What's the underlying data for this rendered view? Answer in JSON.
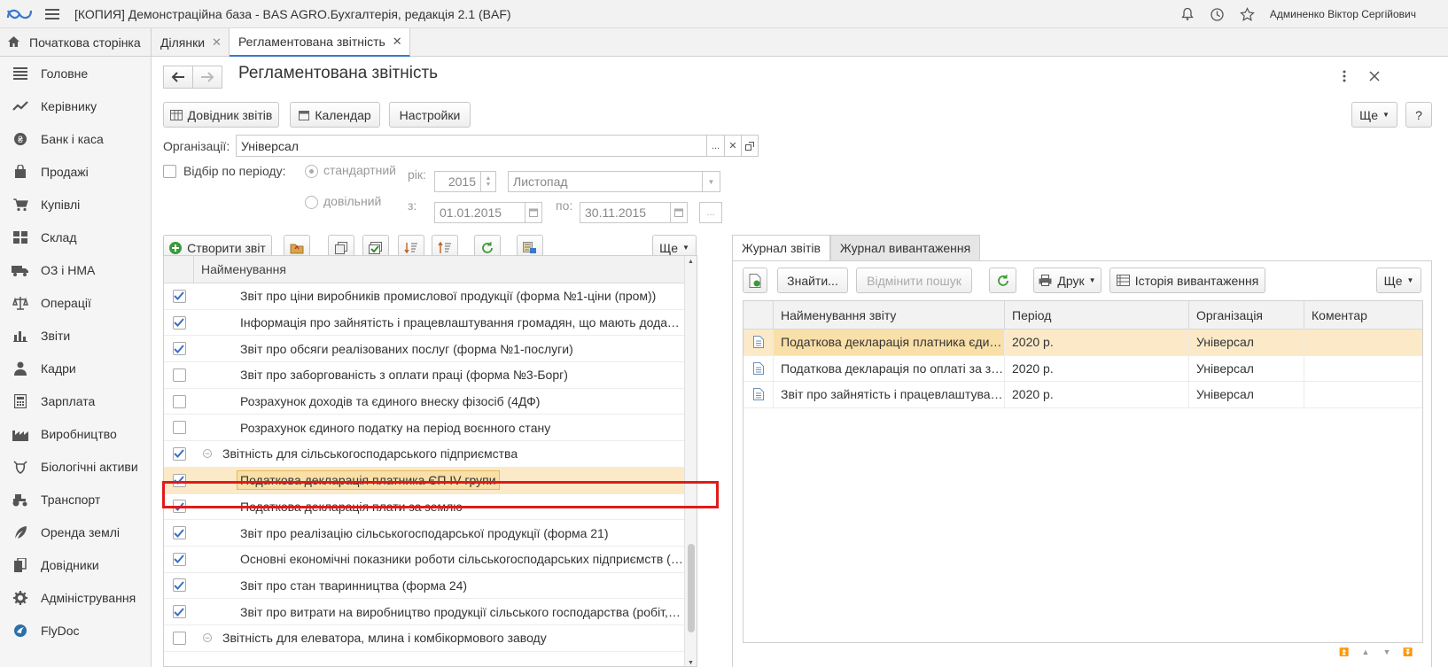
{
  "app": {
    "title": "[КОПИЯ] Демонстраційна база - BAS AGRO.Бухгалтерія, редакція 2.1  (BAF)",
    "user": "Админенко Віктор Сергійович"
  },
  "tabs": {
    "home": "Початкова сторінка",
    "items": [
      {
        "label": "Ділянки"
      },
      {
        "label": "Регламентована звітність"
      }
    ]
  },
  "sidebar": {
    "items": [
      {
        "label": "Головне",
        "icon": "list-icon"
      },
      {
        "label": "Керівнику",
        "icon": "trend-icon"
      },
      {
        "label": "Банк і каса",
        "icon": "coin-icon"
      },
      {
        "label": "Продажі",
        "icon": "bag-icon"
      },
      {
        "label": "Купівлі",
        "icon": "cart-icon"
      },
      {
        "label": "Склад",
        "icon": "grid-icon"
      },
      {
        "label": "ОЗ і НМА",
        "icon": "truck-icon"
      },
      {
        "label": "Операції",
        "icon": "scales-icon"
      },
      {
        "label": "Звіти",
        "icon": "bar-chart-icon"
      },
      {
        "label": "Кадри",
        "icon": "person-icon"
      },
      {
        "label": "Зарплата",
        "icon": "calculator-icon"
      },
      {
        "label": "Виробництво",
        "icon": "factory-icon"
      },
      {
        "label": "Біологічні активи",
        "icon": "cow-icon"
      },
      {
        "label": "Транспорт",
        "icon": "tractor-icon"
      },
      {
        "label": "Оренда землі",
        "icon": "feather-icon"
      },
      {
        "label": "Довідники",
        "icon": "books-icon"
      },
      {
        "label": "Адміністрування",
        "icon": "gear-icon"
      },
      {
        "label": "FlyDoc",
        "icon": "flydoc-icon"
      }
    ]
  },
  "page": {
    "title": "Регламентована звітність"
  },
  "toolbar": {
    "directory": "Довідник звітів",
    "calendar": "Календар",
    "settings": "Настройки",
    "more": "Ще",
    "help": "?"
  },
  "filters": {
    "org_label": "Організації:",
    "org_value": "Універсал",
    "org_select": "...",
    "period_filter_label": "Відбір по періоду:",
    "radio_standard": "стандартний",
    "radio_custom": "довільний",
    "year_label": "рік:",
    "year_value": "2015",
    "month_value": "Листопад",
    "from_label": "з:",
    "from_value": "01.01.2015",
    "to_label": "по:",
    "to_value": "30.11.2015",
    "range_btn": "..."
  },
  "left": {
    "create_btn": "Створити звіт",
    "more": "Ще",
    "column_header": "Найменування",
    "rows": [
      {
        "text": "Звіт про ціни виробників промислової продукції (форма №1-ціни (пром))",
        "checked": true,
        "level": 2
      },
      {
        "text": "Інформація про зайнятість і працевлаштування громадян, що мають додаткові …",
        "checked": true,
        "level": 2
      },
      {
        "text": "Звіт про обсяги реалізованих послуг (форма №1-послуги)",
        "checked": true,
        "level": 2
      },
      {
        "text": "Звіт про заборгованість з оплати праці (форма №3-Борг)",
        "checked": false,
        "level": 2
      },
      {
        "text": "Розрахунок доходів та єдиного внеску фізосіб (4ДФ)",
        "checked": false,
        "level": 2
      },
      {
        "text": "Розрахунок єдиного податку на період воєнного стану",
        "checked": false,
        "level": 2
      },
      {
        "text": "Звітність для сільськогосподарського підприємства",
        "checked": true,
        "level": 1,
        "group": true
      },
      {
        "text": "Податкова декларація платника ЄП IV групи",
        "checked": true,
        "level": 2,
        "selected": true
      },
      {
        "text": "Податкова декларація плати за землю",
        "checked": true,
        "level": 2
      },
      {
        "text": "Звіт про реалізацію сільськогосподарської продукції (форма 21)",
        "checked": true,
        "level": 2
      },
      {
        "text": "Основні економічні показники роботи сільськогосподарських підприємств  (фор…",
        "checked": true,
        "level": 2
      },
      {
        "text": "Звіт про стан тваринництва (форма 24)",
        "checked": true,
        "level": 2
      },
      {
        "text": "Звіт про витрати на виробництво продукції сільського господарства (робіт, посл…",
        "checked": true,
        "level": 2
      },
      {
        "text": "Звітність для елеватора, млина і комбікормового заводу",
        "checked": false,
        "level": 1,
        "group": true
      }
    ]
  },
  "right": {
    "tabs": [
      "Журнал звітів",
      "Журнал вивантаження"
    ],
    "find": "Знайти...",
    "cancel_search": "Відмінити пошук",
    "print": "Друк",
    "history": "Історія вивантаження",
    "more": "Ще",
    "columns": [
      "Найменування звіту",
      "Період",
      "Організація",
      "Коментар"
    ],
    "rows": [
      {
        "name": "Податкова декларація платника єди…",
        "period": "2020 р.",
        "org": "Універсал",
        "comment": ""
      },
      {
        "name": "Податкова декларація по оплаті за з…",
        "period": "2020 р.",
        "org": "Універсал",
        "comment": ""
      },
      {
        "name": "Звіт про зайнятість і працевлаштува…",
        "period": "2020 р.",
        "org": "Універсал",
        "comment": ""
      }
    ]
  },
  "colors": {
    "accent": "#3a78c9",
    "selection": "#fbe9c8",
    "highlight_border": "#e01b1b",
    "check": "#3a6fc2"
  }
}
